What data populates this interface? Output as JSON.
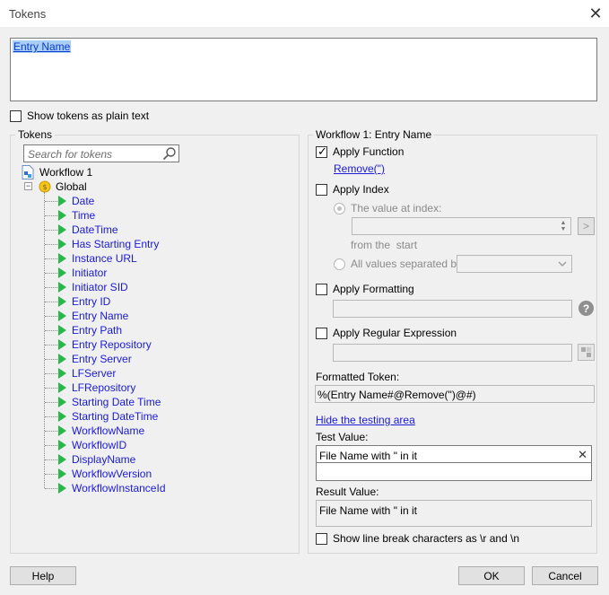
{
  "window": {
    "title": "Tokens"
  },
  "token_expression": {
    "value": "Entry Name"
  },
  "plain_text_option": {
    "label": "Show tokens as plain text",
    "checked": false
  },
  "tokens_panel": {
    "label": "Tokens",
    "search_placeholder": "Search for tokens",
    "workflow_node": "Workflow 1",
    "global_node": "Global",
    "tokens": [
      "Date",
      "Time",
      "DateTime",
      "Has Starting Entry",
      "Instance URL",
      "Initiator",
      "Initiator SID",
      "Entry ID",
      "Entry Name",
      "Entry Path",
      "Entry Repository",
      "Entry Server",
      "LFServer",
      "LFRepository",
      "Starting Date Time",
      "Starting DateTime",
      "WorkflowName",
      "WorkflowID",
      "DisplayName",
      "WorkflowVersion",
      "WorkflowInstanceId"
    ]
  },
  "options_panel": {
    "label": "Workflow 1: Entry Name",
    "apply_function": {
      "label": "Apply Function",
      "checked": true,
      "function_link": "Remove(\")"
    },
    "apply_index": {
      "label": "Apply Index",
      "checked": false,
      "value_at_index_label": "The value at index:",
      "from_label": "from the",
      "start_label": "start",
      "stepper_button": ">",
      "all_values_label": "All values separated by:"
    },
    "apply_formatting": {
      "label": "Apply Formatting",
      "checked": false,
      "help_glyph": "?"
    },
    "apply_regex": {
      "label": "Apply Regular Expression",
      "checked": false
    },
    "formatted_token": {
      "label": "Formatted Token:",
      "value": "%(Entry Name#@Remove(\")@#)"
    },
    "hide_testing_link": "Hide the testing area",
    "test_value": {
      "label": "Test Value:",
      "value": "File Name with \" in it",
      "clear_glyph": "✕"
    },
    "result_value": {
      "label": "Result Value:",
      "value": "File Name with \" in it"
    },
    "line_break_option": {
      "label": "Show line break characters as \\r and \\n",
      "checked": false
    }
  },
  "buttons": {
    "help": "Help",
    "ok": "OK",
    "cancel": "Cancel"
  },
  "colors": {
    "token_link": "#1a1ad6",
    "token_icon": "#27b84a",
    "selection": "#aacff5"
  }
}
